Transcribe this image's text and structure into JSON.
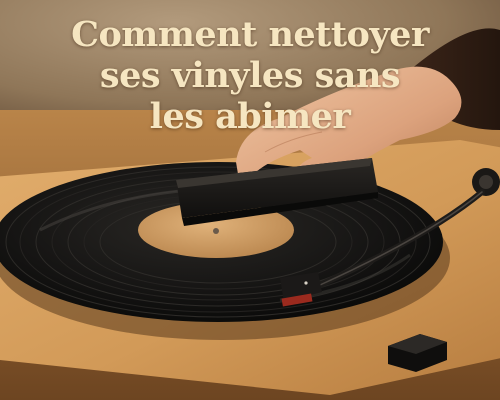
{
  "headline": {
    "line1": "Comment nettoyer",
    "line2": "ses vinyles sans",
    "line3": "les abimer"
  },
  "colors": {
    "headline_text": "#f6e6c1",
    "wall": "#9c8468",
    "turntable_wood": "#d49c5c",
    "vinyl": "#141312",
    "record_label": "#d2a068",
    "brush": "#1a1816"
  },
  "icons": {
    "photo": "vinyl-record-cleaning-photo"
  }
}
